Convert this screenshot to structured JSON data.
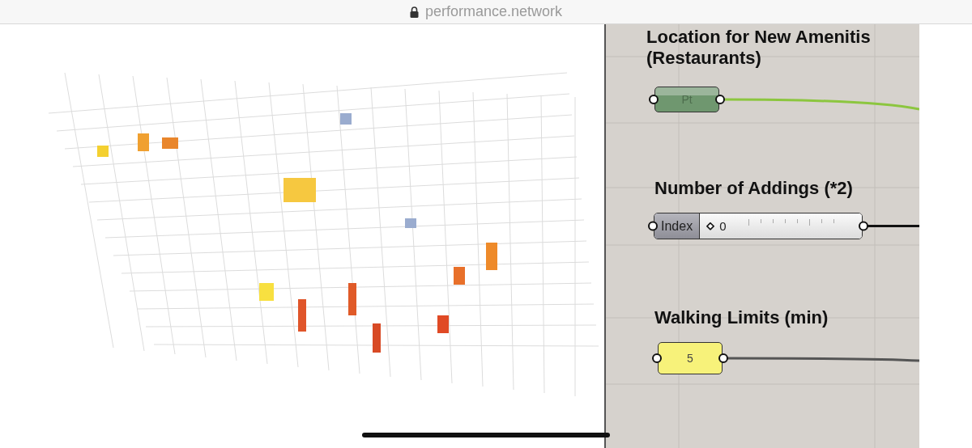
{
  "address_bar": {
    "url": "performance.network",
    "secure": true
  },
  "canvas": {
    "nodes": [
      {
        "kind": "point",
        "title": "Location for New Amenitis (Restaurants)",
        "label": "Pt"
      },
      {
        "kind": "slider",
        "title": "Number of Addings (*2)",
        "label": "Index",
        "value": "0",
        "level": 0
      },
      {
        "kind": "panel",
        "title": "Walking Limits (min)",
        "value": "5"
      }
    ]
  }
}
